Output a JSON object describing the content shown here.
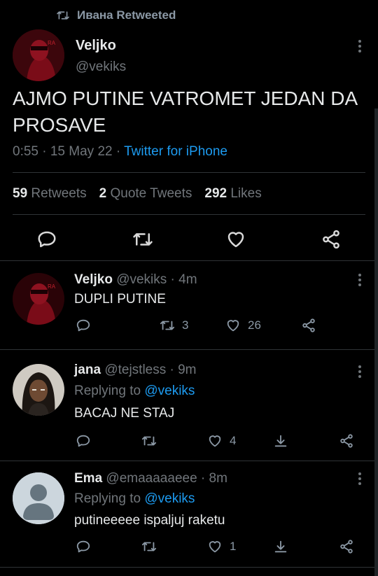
{
  "retweet_banner": {
    "label": "Ивана Retweeted"
  },
  "main_tweet": {
    "name": "Veljko",
    "handle": "@vekiks",
    "text": "AJMO PUTINE VATROMET JEDAN DA PROSAVE",
    "time": "0:55 · 15 May 22 · ",
    "source": "Twitter for iPhone",
    "retweets_count": "59",
    "retweets_label": "Retweets",
    "quotes_count": "2",
    "quotes_label": "Quote Tweets",
    "likes_count": "292",
    "likes_label": "Likes"
  },
  "replies": [
    {
      "name": "Veljko",
      "handle": "@vekiks",
      "time": " · 4m",
      "text": "DUPLI PUTINE",
      "retweets": "3",
      "likes": "26"
    },
    {
      "name": "jana",
      "handle": "@tejstless",
      "time": " · 9m",
      "replying_prefix": "Replying to ",
      "replying_to": "@vekiks",
      "text": "BACAJ NE STAJ",
      "likes": "4"
    },
    {
      "name": "Ema",
      "handle": "@emaaaaaeee",
      "time": " · 8m",
      "replying_prefix": "Replying to ",
      "replying_to": "@vekiks",
      "text": "putineeeee ispaljuj raketu",
      "likes": "1"
    }
  ],
  "icons": {
    "reply": "reply-icon",
    "retweet": "retweet-icon",
    "like": "heart-icon",
    "share": "share-icon",
    "download": "download-icon",
    "more": "more-icon"
  },
  "colors": {
    "link": "#1d9bf0",
    "muted": "#71767b",
    "background": "#000000"
  }
}
